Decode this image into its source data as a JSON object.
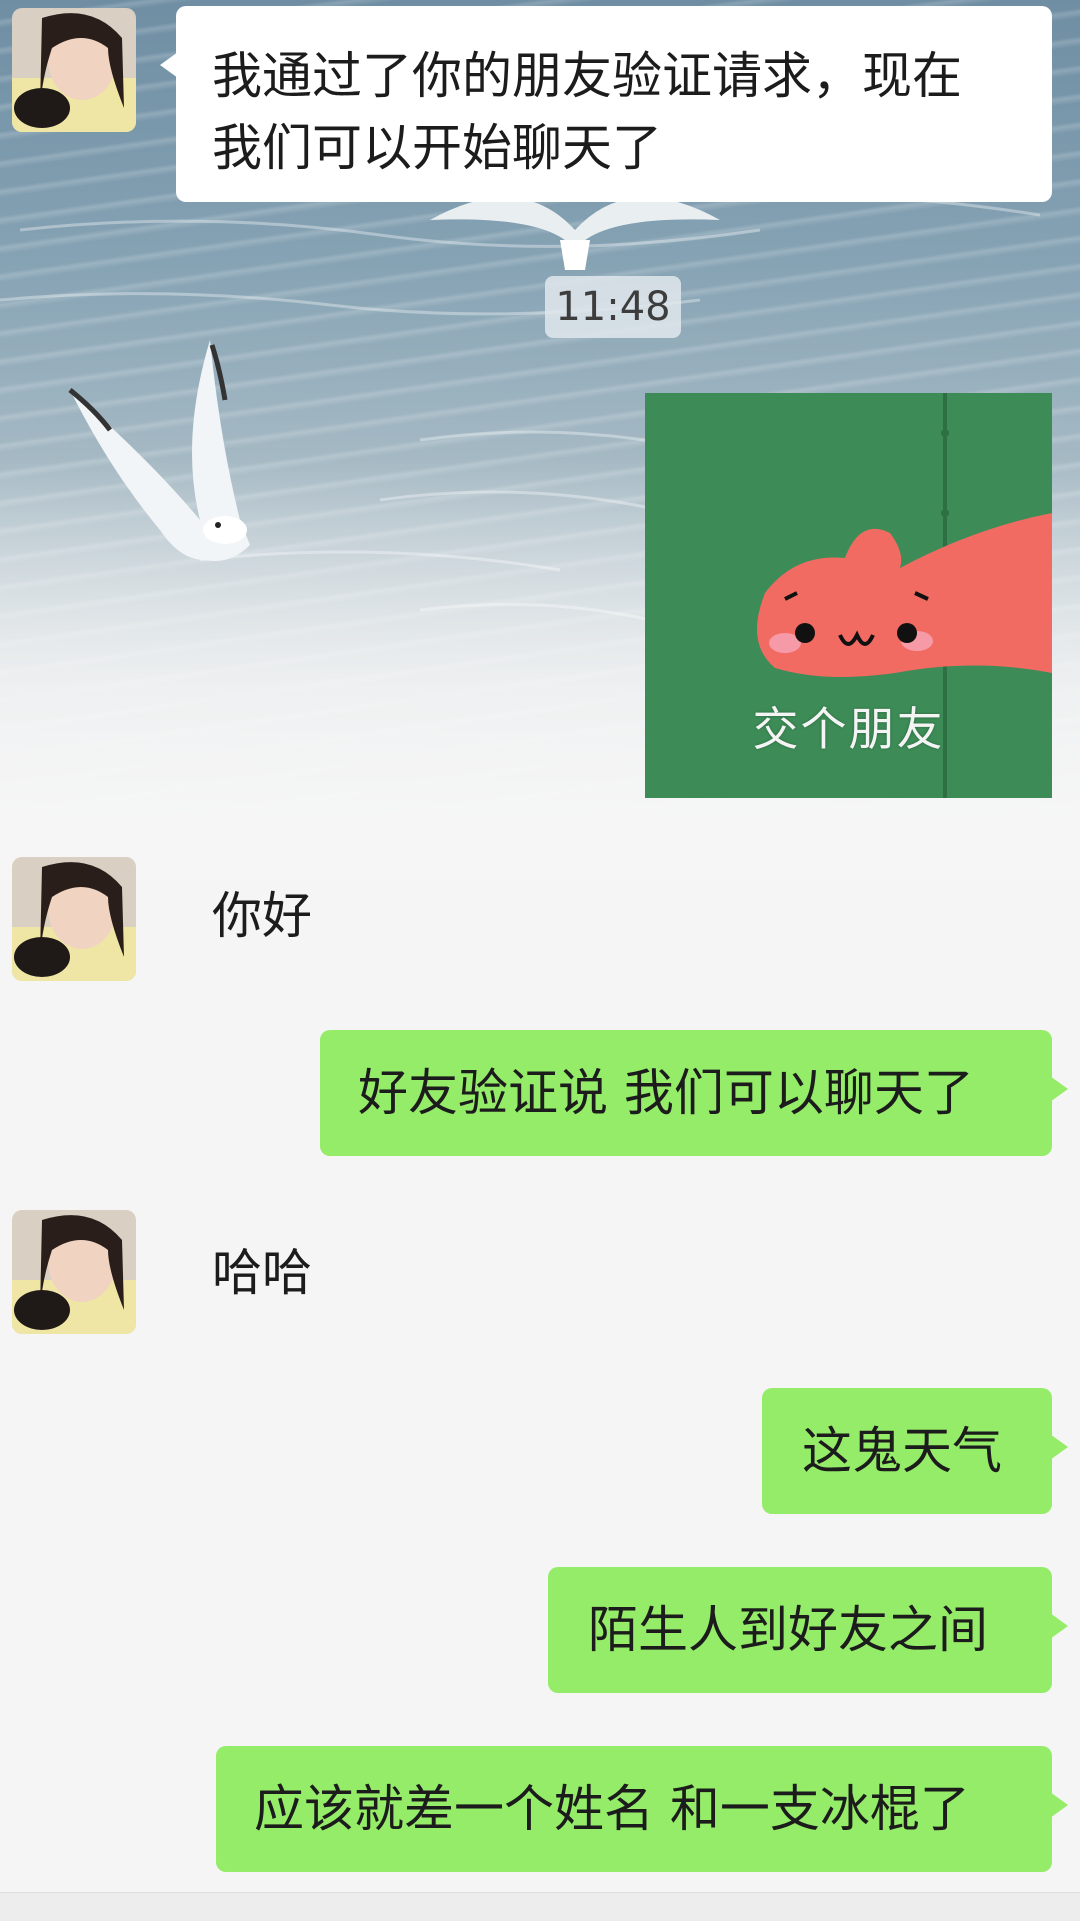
{
  "messages": {
    "m1": "我通过了你的朋友验证请求，现在",
    "m1b": "我们可以开始聊天了",
    "timestamp": "11:48",
    "sticker_caption": "交个朋友",
    "m3": "你好",
    "m4": "好友验证说 我们可以聊天了",
    "m5": "哈哈",
    "m6": "这鬼天气",
    "m7": "陌生人到好友之间",
    "m8": "应该就差一个姓名 和一支冰棍了"
  },
  "colors": {
    "sent_bubble": "#95ec69",
    "received_bubble": "#ffffff",
    "chat_background": "#f5f5f5"
  },
  "icons": {
    "contact_avatar": "avatar-photo",
    "sticker": "pink-starfish-hand-sticker"
  }
}
